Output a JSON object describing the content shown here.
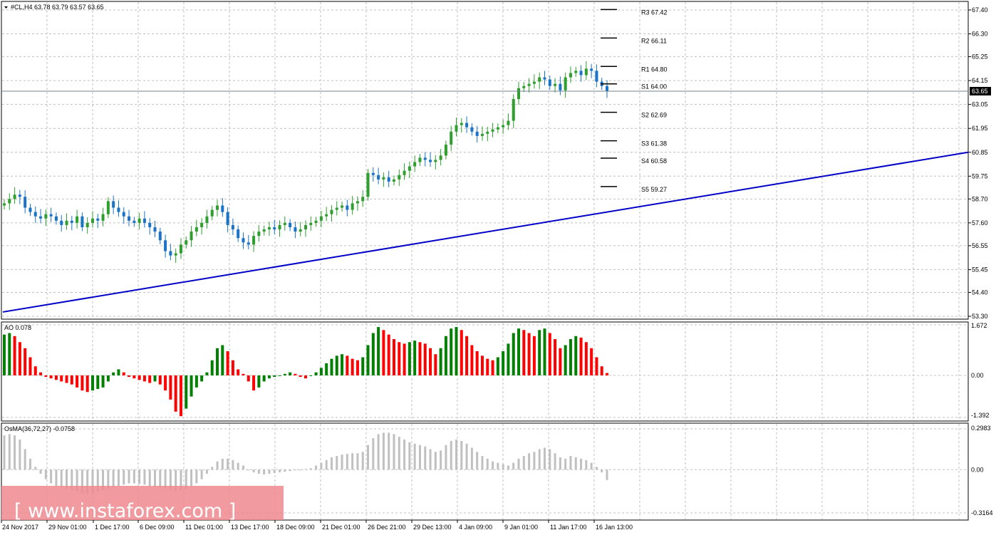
{
  "window": {
    "title": "#CL,H4  63.78 63.79 63.57 63.65",
    "menu_arrow": "triangle-down-icon"
  },
  "colors": {
    "background": "#ffffff",
    "grid": "#c0c0c0",
    "candle_up": "#2e9e2e",
    "candle_down": "#1a73c6",
    "trendline": "#0000c8",
    "ao_up": "#008000",
    "ao_down": "#ff0000",
    "osma": "#c0c0c0",
    "current_price_bg": "#000000",
    "watermark_bg": "#ef8a8f"
  },
  "price_panel": {
    "current_price": "63.65",
    "price_axis": [
      "67.40",
      "66.30",
      "65.25",
      "64.15",
      "63.05",
      "61.95",
      "60.85",
      "59.75",
      "58.70",
      "57.60",
      "56.55",
      "55.45",
      "54.40",
      "53.30"
    ],
    "pivot_levels": [
      {
        "label": "R3 67.42",
        "value": 67.42
      },
      {
        "label": "R2 66.11",
        "value": 66.11
      },
      {
        "label": "R1 64.80",
        "value": 64.8
      },
      {
        "label": "S1 64.00",
        "value": 64.0
      },
      {
        "label": "S2 62.69",
        "value": 62.69
      },
      {
        "label": "S3 61.38",
        "value": 61.38
      },
      {
        "label": "S4 60.58",
        "value": 60.58
      },
      {
        "label": "S5 59.27",
        "value": 59.27
      }
    ]
  },
  "ao_panel": {
    "title": "AO 0.078",
    "axis": [
      "1.672",
      "0.00",
      "-1.392"
    ]
  },
  "osma_panel": {
    "title": "OsMA(36,72,27) -0.0758",
    "axis": [
      "0.2983",
      "0.00",
      "-0.3164"
    ]
  },
  "time_axis": [
    "24 Nov 2017",
    "29 Nov 01:00",
    "1 Dec 17:00",
    "6 Dec 09:00",
    "11 Dec 01:00",
    "13 Dec 17:00",
    "18 Dec 09:00",
    "21 Dec 01:00",
    "26 Dec 21:00",
    "29 Dec 13:00",
    "4 Jan 09:00",
    "9 Jan 01:00",
    "11 Jan 17:00",
    "16 Jan 13:00"
  ],
  "watermark": {
    "text": "[ www.instaforex.com ]"
  },
  "chart_data": {
    "type": "candlestick",
    "symbol": "#CL",
    "timeframe": "H4",
    "ohlc_last": {
      "open": 63.78,
      "high": 63.79,
      "low": 63.57,
      "close": 63.65
    },
    "closes": [
      58.5,
      58.7,
      58.9,
      58.8,
      58.3,
      58.1,
      57.9,
      57.8,
      58.0,
      57.9,
      57.7,
      57.5,
      57.7,
      57.6,
      57.9,
      57.4,
      57.6,
      57.8,
      57.7,
      58.0,
      58.6,
      58.3,
      58.1,
      57.9,
      57.7,
      57.6,
      57.8,
      57.6,
      57.4,
      57.2,
      56.8,
      56.3,
      56.1,
      56.2,
      56.6,
      56.8,
      57.2,
      57.4,
      57.6,
      57.9,
      58.2,
      58.4,
      58.1,
      57.5,
      57.3,
      56.9,
      56.7,
      56.6,
      57.0,
      57.2,
      57.3,
      57.4,
      57.3,
      57.5,
      57.6,
      57.4,
      57.2,
      57.3,
      57.5,
      57.6,
      57.7,
      57.9,
      58.0,
      58.2,
      58.3,
      58.4,
      58.2,
      58.5,
      58.6,
      58.8,
      59.9,
      59.8,
      59.6,
      59.7,
      59.5,
      59.6,
      59.8,
      60.0,
      60.2,
      60.4,
      60.6,
      60.5,
      60.4,
      60.5,
      60.7,
      61.2,
      61.8,
      62.1,
      62.2,
      62.0,
      61.8,
      61.6,
      61.7,
      61.8,
      61.9,
      62.0,
      62.1,
      62.3,
      63.3,
      63.8,
      63.9,
      64.0,
      64.1,
      64.3,
      64.2,
      63.9,
      64.0,
      63.7,
      64.3,
      64.5,
      64.6,
      64.4,
      64.7,
      64.6,
      64.1,
      63.9,
      63.65
    ],
    "trendline": {
      "start": {
        "x": "24 Nov 2017",
        "y": 53.4
      },
      "end": {
        "x": "16 Jan 13:00+",
        "y": 60.85
      }
    },
    "indicators": {
      "AO": {
        "last": 0.078,
        "ylim": [
          -1.392,
          1.672
        ],
        "values": [
          1.35,
          1.4,
          1.3,
          1.1,
          0.9,
          0.6,
          0.3,
          0.1,
          -0.05,
          -0.1,
          -0.15,
          -0.2,
          -0.25,
          -0.3,
          -0.4,
          -0.5,
          -0.55,
          -0.5,
          -0.45,
          -0.4,
          -0.2,
          0.1,
          0.2,
          0.1,
          -0.05,
          -0.1,
          -0.15,
          -0.2,
          -0.25,
          -0.2,
          -0.3,
          -0.5,
          -0.8,
          -1.2,
          -1.35,
          -1.1,
          -0.7,
          -0.4,
          -0.2,
          0.1,
          0.5,
          0.9,
          1.0,
          0.8,
          0.5,
          0.2,
          0.05,
          -0.2,
          -0.5,
          -0.4,
          -0.2,
          -0.1,
          -0.05,
          0.0,
          0.05,
          0.1,
          0.05,
          -0.05,
          -0.1,
          0.0,
          0.1,
          0.25,
          0.4,
          0.55,
          0.65,
          0.7,
          0.65,
          0.55,
          0.5,
          0.6,
          1.0,
          1.4,
          1.6,
          1.5,
          1.35,
          1.2,
          1.1,
          1.05,
          1.1,
          1.15,
          1.1,
          1.05,
          0.9,
          0.7,
          0.9,
          1.3,
          1.55,
          1.6,
          1.5,
          1.3,
          1.0,
          0.8,
          0.65,
          0.55,
          0.5,
          0.6,
          0.8,
          1.05,
          1.4,
          1.55,
          1.5,
          1.4,
          1.3,
          1.5,
          1.55,
          1.4,
          1.2,
          0.9,
          1.0,
          1.2,
          1.3,
          1.25,
          1.1,
          0.9,
          0.6,
          0.3,
          0.078
        ]
      },
      "OsMA": {
        "params": "36,72,27",
        "last": -0.0758,
        "ylim": [
          -0.3164,
          0.2983
        ],
        "values": [
          0.25,
          0.26,
          0.25,
          0.22,
          0.15,
          0.08,
          0.02,
          -0.03,
          -0.07,
          -0.1,
          -0.12,
          -0.13,
          -0.14,
          -0.15,
          -0.16,
          -0.17,
          -0.175,
          -0.17,
          -0.16,
          -0.15,
          -0.14,
          -0.13,
          -0.12,
          -0.11,
          -0.1,
          -0.1,
          -0.105,
          -0.11,
          -0.12,
          -0.125,
          -0.13,
          -0.14,
          -0.15,
          -0.155,
          -0.15,
          -0.14,
          -0.12,
          -0.1,
          -0.07,
          -0.03,
          0.02,
          0.06,
          0.08,
          0.08,
          0.07,
          0.05,
          0.03,
          0.0,
          -0.02,
          -0.03,
          -0.035,
          -0.03,
          -0.025,
          -0.02,
          -0.015,
          -0.01,
          -0.005,
          0.0,
          0.005,
          0.01,
          0.03,
          0.05,
          0.07,
          0.09,
          0.1,
          0.11,
          0.115,
          0.12,
          0.12,
          0.13,
          0.18,
          0.23,
          0.26,
          0.27,
          0.27,
          0.26,
          0.24,
          0.22,
          0.2,
          0.19,
          0.18,
          0.17,
          0.15,
          0.13,
          0.14,
          0.18,
          0.21,
          0.22,
          0.21,
          0.19,
          0.16,
          0.13,
          0.1,
          0.08,
          0.06,
          0.05,
          0.04,
          0.03,
          0.05,
          0.08,
          0.1,
          0.12,
          0.13,
          0.15,
          0.16,
          0.15,
          0.12,
          0.09,
          0.08,
          0.1,
          0.09,
          0.08,
          0.07,
          0.05,
          0.02,
          -0.02,
          -0.0758
        ]
      }
    }
  }
}
